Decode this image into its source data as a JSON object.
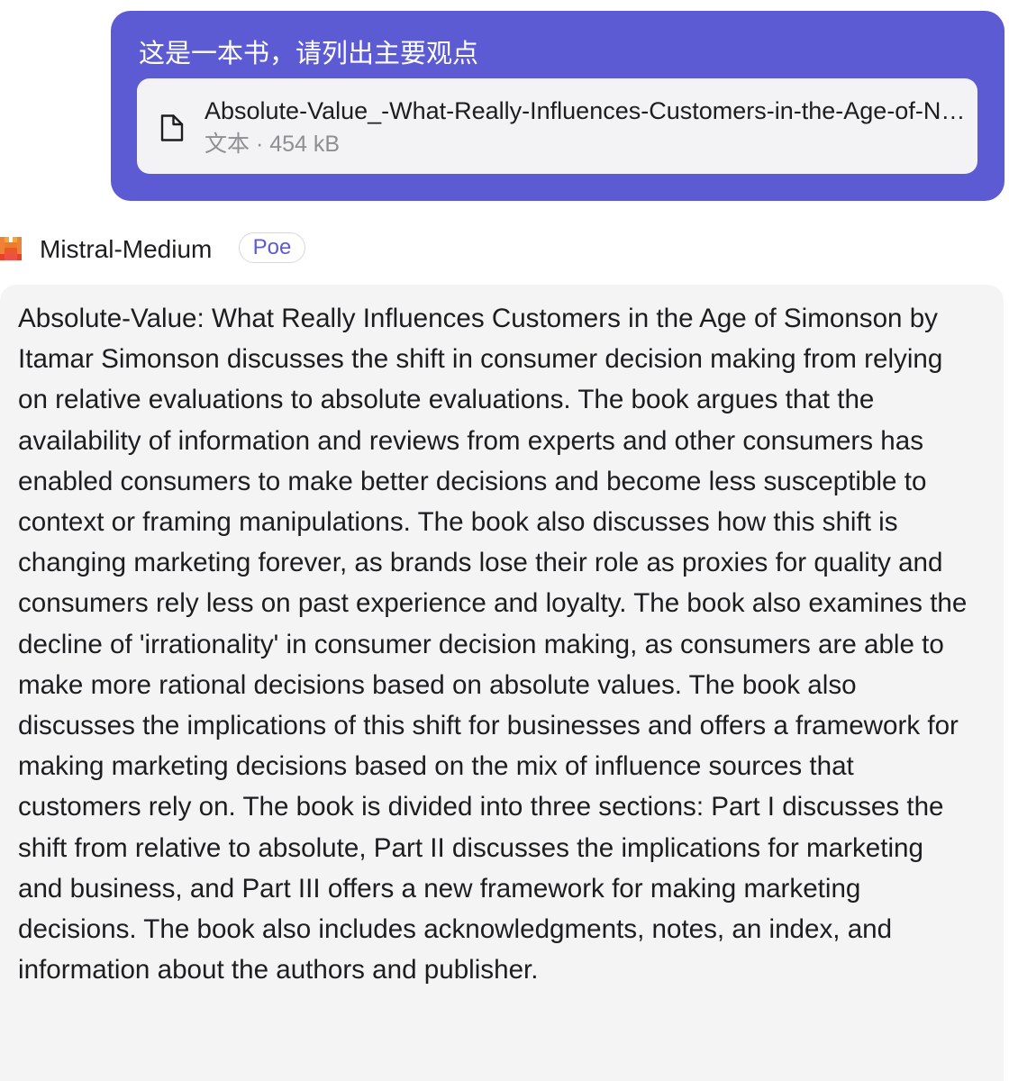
{
  "user_message": {
    "text": "这是一本书，请列出主要观点",
    "attachment": {
      "icon": "document-icon",
      "file_name": "Absolute-Value_-What-Really-Influences-Customers-in-the-Age-of-Nearly-Perfect-Information.txt",
      "file_type": "文本",
      "file_size": "454 kB"
    }
  },
  "bot": {
    "avatar_icon": "mistral-logo-icon",
    "name": "Mistral-Medium",
    "badge": "Poe"
  },
  "bot_message": {
    "text": "Absolute-Value: What Really Influences Customers in the Age of Simonson by Itamar Simonson discusses the shift in consumer decision making from relying on relative evaluations to absolute evaluations. The book argues that the availability of information and reviews from experts and other consumers has enabled consumers to make better decisions and become less susceptible to context or framing manipulations. The book also discusses how this shift is changing marketing forever, as brands lose their role as proxies for quality and consumers rely less on past experience and loyalty. The book also examines the decline of 'irrationality' in consumer decision making, as consumers are able to make more rational decisions based on absolute values. The book also discusses the implications of this shift for businesses and offers a framework for making marketing decisions based on the mix of influence sources that customers rely on. The book is divided into three sections: Part I discusses the shift from relative to absolute, Part II discusses the implications for marketing and business, and Part III offers a new framework for making marketing decisions. The book also includes acknowledgments, notes, an index, and information about the authors and publisher."
  },
  "colors": {
    "user_bubble": "#5d5bd4",
    "attachment_bg": "#f3f3f5",
    "bot_bubble": "#f4f4f5",
    "badge_text": "#5d5bd4"
  }
}
